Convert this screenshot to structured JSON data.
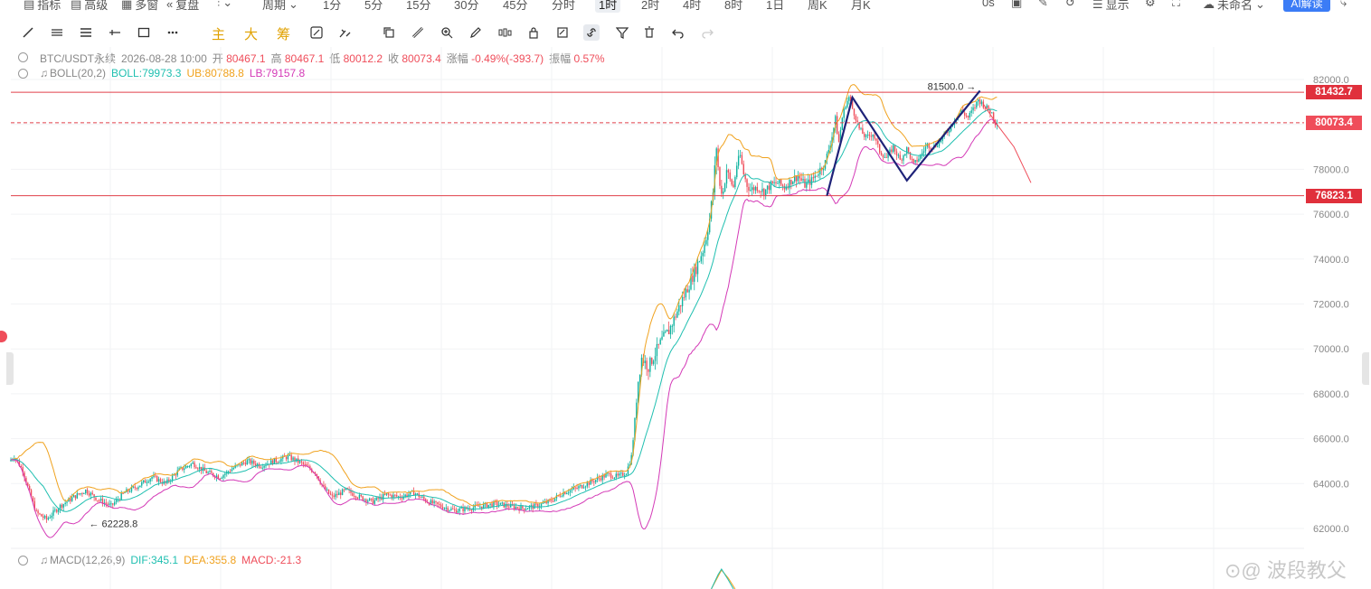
{
  "toolbar": {
    "items": [
      "指标",
      "高级",
      "多窗",
      "复盘",
      "周期",
      "1分",
      "5分",
      "15分",
      "30分",
      "45分",
      "分时",
      "1时",
      "2时",
      "4时",
      "8时",
      "1日",
      "周K",
      "月K"
    ],
    "active": "1时",
    "right": {
      "countdown": "0s",
      "display": "显示",
      "account": "未命名",
      "ai": "AI解读"
    }
  },
  "draw_toolbar": {
    "labels": [
      "主",
      "大",
      "筹"
    ]
  },
  "info": {
    "symbol": "BTC/USDT永续",
    "datetime": "2026-08-28 10:00",
    "open_label": "开",
    "open": "80467.1",
    "high_label": "高",
    "high": "80467.1",
    "low_label": "低",
    "low": "80012.2",
    "close_label": "收",
    "close": "80073.4",
    "change_label": "涨幅",
    "change": "-0.49%(-393.7)",
    "amp_label": "振幅",
    "amp": "0.57%"
  },
  "boll": {
    "name": "BOLL(20,2)",
    "mid": "BOLL:79973.3",
    "ub": "UB:80788.8",
    "lb": "LB:79157.8"
  },
  "macd": {
    "name": "MACD(12,26,9)",
    "dif": "DIF:345.1",
    "dea": "DEA:355.8",
    "macd": "MACD:-21.3"
  },
  "watermark": "波段教父",
  "colors": {
    "up": "#0fb29f",
    "down": "#ef4d5a",
    "ub": "#f0a21e",
    "mid": "#1fbfb0",
    "lb": "#d43ab7",
    "pattern": "#1e2278",
    "level": "#e0404a"
  },
  "chart_data": {
    "type": "candlestick",
    "interval": "1时",
    "y_axis": {
      "ticks": [
        "82000.0",
        "80000.0",
        "78000.0",
        "76000.0",
        "74000.0",
        "72000.0",
        "70000.0",
        "68000.0",
        "66000.0",
        "64000.0",
        "62000.0"
      ],
      "ylim": [
        61400,
        82800
      ],
      "grid": true
    },
    "horizontal_levels": [
      {
        "price": 81432.7,
        "label": "81432.7",
        "style": "solid"
      },
      {
        "price": 80073.4,
        "label": "80073.4",
        "style": "dashed"
      },
      {
        "price": 76823.1,
        "label": "76823.1",
        "style": "solid"
      }
    ],
    "annotations": [
      {
        "label": "81500.0",
        "price": 81500
      },
      {
        "label": "← 62228.8",
        "price": 62228.8
      }
    ],
    "price_path": [
      [
        0,
        65000
      ],
      [
        3,
        65200
      ],
      [
        8,
        64600
      ],
      [
        12,
        63600
      ],
      [
        16,
        62700
      ],
      [
        22,
        62400
      ],
      [
        30,
        63000
      ],
      [
        38,
        63400
      ],
      [
        45,
        63700
      ],
      [
        52,
        63300
      ],
      [
        60,
        63000
      ],
      [
        68,
        63600
      ],
      [
        76,
        63900
      ],
      [
        84,
        64300
      ],
      [
        92,
        64000
      ],
      [
        100,
        64600
      ],
      [
        108,
        64900
      ],
      [
        116,
        64500
      ],
      [
        124,
        64300
      ],
      [
        132,
        64700
      ],
      [
        140,
        65000
      ],
      [
        148,
        64800
      ],
      [
        156,
        65000
      ],
      [
        164,
        65200
      ],
      [
        172,
        64900
      ],
      [
        180,
        64500
      ],
      [
        185,
        63800
      ],
      [
        190,
        63400
      ],
      [
        198,
        63700
      ],
      [
        206,
        63400
      ],
      [
        214,
        63200
      ],
      [
        222,
        63500
      ],
      [
        230,
        63400
      ],
      [
        238,
        63600
      ],
      [
        246,
        63200
      ],
      [
        254,
        63000
      ],
      [
        262,
        62800
      ],
      [
        270,
        62900
      ],
      [
        278,
        63000
      ],
      [
        286,
        63100
      ],
      [
        294,
        63000
      ],
      [
        302,
        62900
      ],
      [
        310,
        63000
      ],
      [
        318,
        63200
      ],
      [
        326,
        63600
      ],
      [
        334,
        63800
      ],
      [
        340,
        64000
      ],
      [
        346,
        64200
      ],
      [
        352,
        64400
      ],
      [
        358,
        64300
      ],
      [
        363,
        64500
      ],
      [
        366,
        65200
      ],
      [
        368,
        66800
      ],
      [
        370,
        68600
      ],
      [
        372,
        69600
      ],
      [
        376,
        69200
      ],
      [
        380,
        69800
      ],
      [
        384,
        70400
      ],
      [
        388,
        70800
      ],
      [
        392,
        71500
      ],
      [
        396,
        72200
      ],
      [
        400,
        72900
      ],
      [
        404,
        73600
      ],
      [
        408,
        74400
      ],
      [
        410,
        75000
      ],
      [
        412,
        75800
      ],
      [
        414,
        77000
      ],
      [
        416,
        79000
      ],
      [
        418,
        77200
      ],
      [
        420,
        77000
      ],
      [
        422,
        78000
      ],
      [
        424,
        77500
      ],
      [
        426,
        77200
      ],
      [
        428,
        78200
      ],
      [
        430,
        78600
      ],
      [
        432,
        77800
      ],
      [
        434,
        77300
      ],
      [
        436,
        77100
      ],
      [
        440,
        77200
      ],
      [
        444,
        77000
      ],
      [
        448,
        77300
      ],
      [
        452,
        77400
      ],
      [
        456,
        77200
      ],
      [
        460,
        77500
      ],
      [
        464,
        77700
      ],
      [
        468,
        77300
      ],
      [
        472,
        77500
      ],
      [
        476,
        77900
      ],
      [
        480,
        78300
      ],
      [
        484,
        79500
      ],
      [
        486,
        80200
      ],
      [
        488,
        79200
      ],
      [
        490,
        80300
      ],
      [
        492,
        80900
      ],
      [
        494,
        81200
      ],
      [
        496,
        80700
      ],
      [
        498,
        80300
      ],
      [
        500,
        79800
      ],
      [
        504,
        79400
      ],
      [
        508,
        79600
      ],
      [
        512,
        78800
      ],
      [
        516,
        78500
      ],
      [
        520,
        79000
      ],
      [
        524,
        78400
      ],
      [
        528,
        78900
      ],
      [
        532,
        78200
      ],
      [
        536,
        78600
      ],
      [
        540,
        79100
      ],
      [
        544,
        79000
      ],
      [
        548,
        79300
      ],
      [
        552,
        79700
      ],
      [
        556,
        80200
      ],
      [
        560,
        80600
      ],
      [
        564,
        80300
      ],
      [
        568,
        80800
      ],
      [
        570,
        81100
      ],
      [
        574,
        80800
      ],
      [
        578,
        80500
      ],
      [
        580,
        80073
      ]
    ],
    "volatility": [
      [
        0,
        400
      ],
      [
        350,
        400
      ],
      [
        364,
        450
      ],
      [
        368,
        900
      ],
      [
        416,
        900
      ],
      [
        418,
        650
      ],
      [
        484,
        650
      ],
      [
        486,
        450
      ],
      [
        580,
        450
      ]
    ],
    "patterns": {
      "w_pattern": [
        [
          76823,
          "low"
        ],
        [
          81200,
          "peak"
        ],
        [
          77500,
          "trough"
        ],
        [
          81500,
          "peak"
        ]
      ]
    },
    "projection": [
      80900,
      80000,
      79000,
      77400
    ]
  }
}
